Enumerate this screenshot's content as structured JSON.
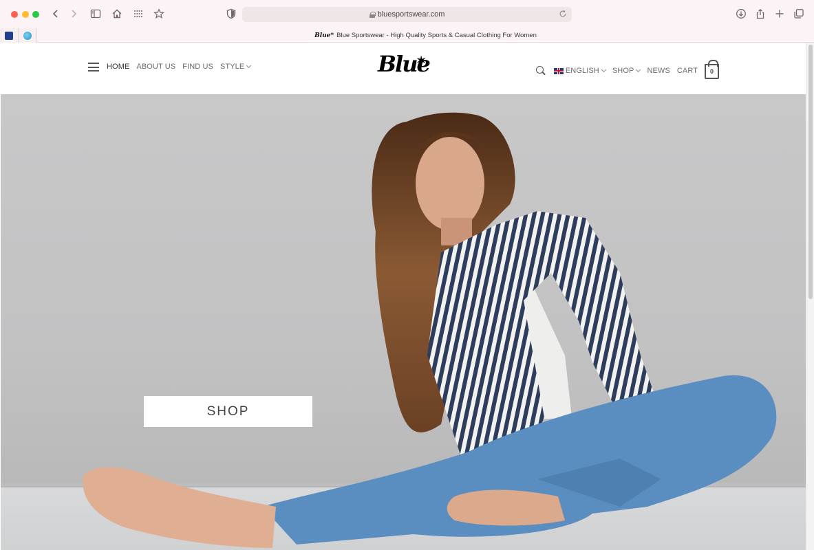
{
  "browser": {
    "url": "bluesportswear.com",
    "tab_title": "Blue Sportswear - High Quality Sports & Casual Clothing For Women",
    "tab_favicon_text": "Blue*",
    "toolbar_icons": [
      "back-icon",
      "forward-icon",
      "sidebar-icon",
      "home-icon",
      "grid-icon",
      "star-icon",
      "shield-icon",
      "reload-icon",
      "download-icon",
      "share-icon",
      "new-tab-icon",
      "tabs-overview-icon"
    ]
  },
  "site": {
    "logo_text": "Blue",
    "logo_star": "✶",
    "nav_left": [
      {
        "label": "HOME"
      },
      {
        "label": "ABOUT US"
      },
      {
        "label": "FIND US"
      },
      {
        "label": "STYLE"
      }
    ],
    "nav_right": {
      "language": "ENGLISH",
      "shop": "SHOP",
      "news": "NEWS",
      "cart": "CART",
      "cart_count": "0"
    }
  },
  "hero": {
    "cta_label": "SHOP"
  },
  "colors": {
    "chrome_bg": "#fbf3f5",
    "hero_bg": "#c4c4c5",
    "shirt_stripe": "#2f3d5c",
    "jeans": "#5b8ec0"
  }
}
